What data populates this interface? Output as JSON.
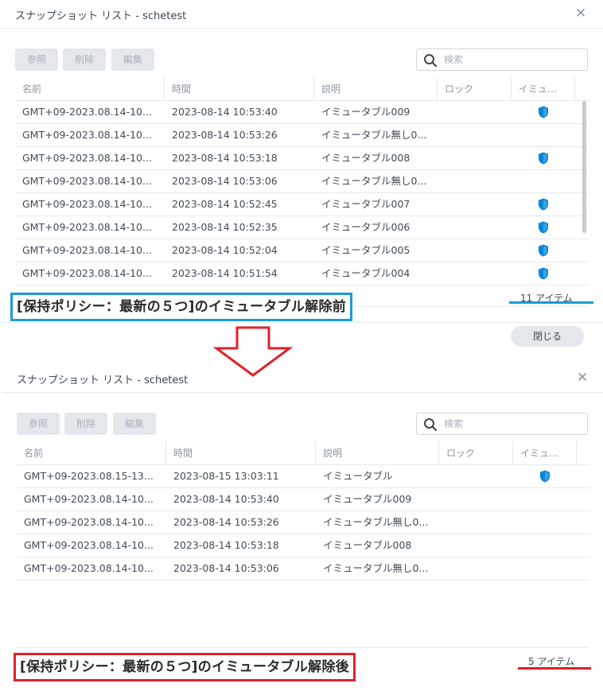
{
  "panels": [
    {
      "title": "スナップショット リスト - schetest",
      "toolbar": {
        "ref_label": "参照",
        "delete_label": "削除",
        "edit_label": "編集",
        "search_placeholder": "検索"
      },
      "columns": [
        "名前",
        "時間",
        "説明",
        "ロック",
        "イミュ…"
      ],
      "rows": [
        {
          "name": "GMT+09-2023.08.14-10...",
          "time": "2023-08-14 10:53:40",
          "desc": "イミュータブル009",
          "immutable": true
        },
        {
          "name": "GMT+09-2023.08.14-10...",
          "time": "2023-08-14 10:53:26",
          "desc": "イミュータブル無し0...",
          "immutable": false
        },
        {
          "name": "GMT+09-2023.08.14-10...",
          "time": "2023-08-14 10:53:18",
          "desc": "イミュータブル008",
          "immutable": true
        },
        {
          "name": "GMT+09-2023.08.14-10...",
          "time": "2023-08-14 10:53:06",
          "desc": "イミュータブル無し0...",
          "immutable": false
        },
        {
          "name": "GMT+09-2023.08.14-10...",
          "time": "2023-08-14 10:52:45",
          "desc": "イミュータブル007",
          "immutable": true
        },
        {
          "name": "GMT+09-2023.08.14-10...",
          "time": "2023-08-14 10:52:35",
          "desc": "イミュータブル006",
          "immutable": true
        },
        {
          "name": "GMT+09-2023.08.14-10...",
          "time": "2023-08-14 10:52:04",
          "desc": "イミュータブル005",
          "immutable": true
        },
        {
          "name": "GMT+09-2023.08.14-10...",
          "time": "2023-08-14 10:51:54",
          "desc": "イミュータブル004",
          "immutable": true
        }
      ],
      "item_count": "11 アイテム",
      "caption": "[保持ポリシー：最新の５つ]のイミュータブル解除前",
      "close_label": "閉じる"
    },
    {
      "title": "スナップショット リスト - schetest",
      "toolbar": {
        "ref_label": "参照",
        "delete_label": "削除",
        "edit_label": "編集",
        "search_placeholder": "検索"
      },
      "columns": [
        "名前",
        "時間",
        "説明",
        "ロック",
        "イミュ…"
      ],
      "rows": [
        {
          "name": "GMT+09-2023.08.15-13...",
          "time": "2023-08-15 13:03:11",
          "desc": "イミュータブル",
          "immutable": true
        },
        {
          "name": "GMT+09-2023.08.14-10...",
          "time": "2023-08-14 10:53:40",
          "desc": "イミュータブル009",
          "immutable": false
        },
        {
          "name": "GMT+09-2023.08.14-10...",
          "time": "2023-08-14 10:53:26",
          "desc": "イミュータブル無し0...",
          "immutable": false
        },
        {
          "name": "GMT+09-2023.08.14-10...",
          "time": "2023-08-14 10:53:18",
          "desc": "イミュータブル008",
          "immutable": false
        },
        {
          "name": "GMT+09-2023.08.14-10...",
          "time": "2023-08-14 10:53:06",
          "desc": "イミュータブル無し0...",
          "immutable": false
        }
      ],
      "item_count": "5 アイテム",
      "caption": "[保持ポリシー：最新の５つ]のイミュータブル解除後"
    }
  ],
  "colors": {
    "blue_highlight": "#1a9bd7",
    "red_highlight": "#e0202a",
    "arrow_red": "#e0202a",
    "shield_blue": "#0a84d6"
  }
}
